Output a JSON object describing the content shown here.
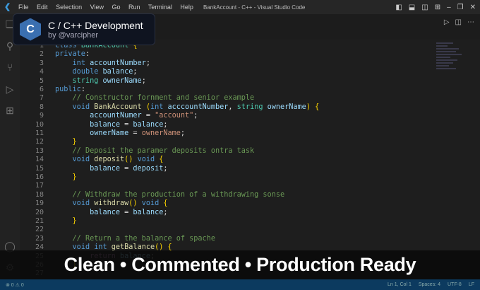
{
  "titlebar": {
    "menu": [
      "File",
      "Edit",
      "Selection",
      "View",
      "Go",
      "Run",
      "Terminal",
      "Help"
    ],
    "title": "BankAccount - C++ - Visual Studio Code"
  },
  "badge": {
    "logo_text": "C",
    "title": "C / C++ Development",
    "subtitle": "by @varcipher"
  },
  "editor": {
    "lines": [
      [
        [
          "kw",
          "class "
        ],
        [
          "ty",
          "BankAccount "
        ],
        [
          "br",
          "{"
        ]
      ],
      [
        [
          "kw",
          "private"
        ],
        [
          "pl",
          ":"
        ]
      ],
      [
        [
          "pl",
          "    "
        ],
        [
          "kw",
          "int "
        ],
        [
          "id",
          "accountNumber"
        ],
        [
          "pl",
          ";"
        ]
      ],
      [
        [
          "pl",
          "    "
        ],
        [
          "kw",
          "double "
        ],
        [
          "id",
          "balance"
        ],
        [
          "pl",
          ";"
        ]
      ],
      [
        [
          "pl",
          "    "
        ],
        [
          "ty",
          "string "
        ],
        [
          "id",
          "ownerName"
        ],
        [
          "pl",
          ";"
        ]
      ],
      [
        [
          "kw",
          "public"
        ],
        [
          "pl",
          ":"
        ]
      ],
      [
        [
          "pl",
          "    "
        ],
        [
          "cm",
          "// Constructor fornment and senior example"
        ]
      ],
      [
        [
          "pl",
          "    "
        ],
        [
          "kw",
          "void "
        ],
        [
          "fn",
          "BankAccount "
        ],
        [
          "br",
          "("
        ],
        [
          "kw",
          "int "
        ],
        [
          "id",
          "acccountNumber"
        ],
        [
          "pl",
          ", "
        ],
        [
          "ty",
          "string "
        ],
        [
          "id",
          "ownerName"
        ],
        [
          "br",
          ") {"
        ]
      ],
      [
        [
          "pl",
          "        "
        ],
        [
          "id",
          "accountNumer"
        ],
        [
          "pl",
          " = "
        ],
        [
          "st",
          "\"account\""
        ],
        [
          "pl",
          ";"
        ]
      ],
      [
        [
          "pl",
          "        "
        ],
        [
          "id",
          "balance"
        ],
        [
          "pl",
          " = "
        ],
        [
          "id",
          "balance"
        ],
        [
          "pl",
          ";"
        ]
      ],
      [
        [
          "pl",
          "        "
        ],
        [
          "id",
          "ownerName"
        ],
        [
          "pl",
          " = "
        ],
        [
          "st",
          "ownerName"
        ],
        [
          "pl",
          ";"
        ]
      ],
      [
        [
          "pl",
          "    "
        ],
        [
          "br",
          "}"
        ]
      ],
      [
        [
          "pl",
          "    "
        ],
        [
          "cm",
          "// Deposit the paramer deposits ontra task"
        ]
      ],
      [
        [
          "pl",
          "    "
        ],
        [
          "kw",
          "void "
        ],
        [
          "fn",
          "deposit"
        ],
        [
          "br",
          "() "
        ],
        [
          "kw",
          "void "
        ],
        [
          "br",
          "{"
        ]
      ],
      [
        [
          "pl",
          "        "
        ],
        [
          "id",
          "balance"
        ],
        [
          "pl",
          " = "
        ],
        [
          "id",
          "deposit"
        ],
        [
          "pl",
          ";"
        ]
      ],
      [
        [
          "pl",
          "    "
        ],
        [
          "br",
          "}"
        ]
      ],
      [],
      [
        [
          "pl",
          "    "
        ],
        [
          "cm",
          "// Withdraw the production of a withdrawing sonse"
        ]
      ],
      [
        [
          "pl",
          "    "
        ],
        [
          "kw",
          "void "
        ],
        [
          "fn",
          "withdraw"
        ],
        [
          "br",
          "() "
        ],
        [
          "kw",
          "void "
        ],
        [
          "br",
          "{"
        ]
      ],
      [
        [
          "pl",
          "        "
        ],
        [
          "id",
          "balance"
        ],
        [
          "pl",
          " = "
        ],
        [
          "id",
          "balance"
        ],
        [
          "pl",
          ";"
        ]
      ],
      [
        [
          "pl",
          "    "
        ],
        [
          "br",
          "}"
        ]
      ],
      [],
      [
        [
          "pl",
          "    "
        ],
        [
          "cm",
          "// Return a the balance of spache"
        ]
      ],
      [
        [
          "pl",
          "    "
        ],
        [
          "kw",
          "void "
        ],
        [
          "kw",
          "int "
        ],
        [
          "fn",
          "getBalance"
        ],
        [
          "br",
          "() {"
        ]
      ],
      [
        [
          "pl",
          "        "
        ],
        [
          "rt",
          "return "
        ],
        [
          "id",
          "balance"
        ],
        [
          "pl",
          ";"
        ]
      ],
      [
        [
          "pl",
          "    "
        ],
        [
          "br",
          "}"
        ]
      ],
      [],
      [],
      []
    ]
  },
  "overlay": {
    "caption": "Clean • Commented • Production Ready"
  },
  "statusbar": {
    "items": [
      "Ln 1, Col 1",
      "Spaces: 4",
      "UTF-8",
      "LF"
    ]
  }
}
